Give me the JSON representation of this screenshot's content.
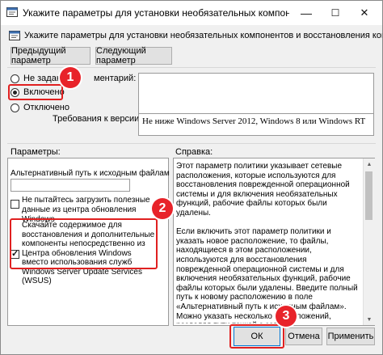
{
  "window": {
    "title": "Укажите параметры для установки необязательных компонентов и восстановления компонент"
  },
  "titlebar_buttons": {
    "minimize": "—",
    "maximize": "☐",
    "close": "✕"
  },
  "header": {
    "policy_name": "Укажите параметры для установки необязательных компонентов и восстановления компонентов",
    "prev_button": "Предыдущий параметр",
    "next_button": "Следующий параметр"
  },
  "state": {
    "options": [
      "Не задано",
      "Включено",
      "Отключено"
    ],
    "selected": "Включено",
    "comment_label": "Комментарий:",
    "comment_label_visible": "ментарий:",
    "comment_value": "",
    "supported_label": "Требования к версии:",
    "supported_value": "Не ниже Windows Server 2012, Windows 8 или Windows RT"
  },
  "params": {
    "section_label": "Параметры:",
    "alt_path_label": "Альтернативный путь к исходным файлам",
    "alt_path_value": "",
    "never_wu_label": "Не пытайтесь загрузить полезные данные из центра обновления Windows",
    "never_wu_checked": false,
    "wu_direct_label": "Скачайте содержимое для восстановления и дополнительные компоненты непосредственно из Центра обновления Windows вместо использования служб Windows Server Update Services (WSUS)",
    "wu_direct_checked": true
  },
  "help": {
    "section_label": "Справка:",
    "text": "Этот параметр политики указывает сетевые расположения, которые используются для восстановления поврежденной операционной системы и для включения необязательных функций, рабочие файлы которых были удалены.\n\nЕсли включить этот параметр политики и указать новое расположение, то файлы, находящиеся в этом расположении, используются для восстановления поврежденной операционной системы и для включения необязательных функций, рабочие файлы которых были удалены. Введите полный путь к новому расположению в поле «Альтернативный путь к исходным файлам». Можно указать несколько расположений, разделяя пути точкой с запятой.\n\nДля сетевого размещения можно указать либо папку, либо WIM-файл. Если выбран WIM-файл, то"
  },
  "footer": {
    "ok": "ОК",
    "cancel": "Отмена",
    "apply": "Применить"
  },
  "annotations": {
    "badge_1": "1",
    "badge_2": "2",
    "badge_3": "3",
    "highlight_color": "#e02020",
    "badge_color": "#e8232a"
  },
  "icons": {
    "window_icon": "policy-settings-icon",
    "scroll_up": "scroll-up-arrow-icon",
    "scroll_down": "scroll-down-arrow-icon"
  }
}
